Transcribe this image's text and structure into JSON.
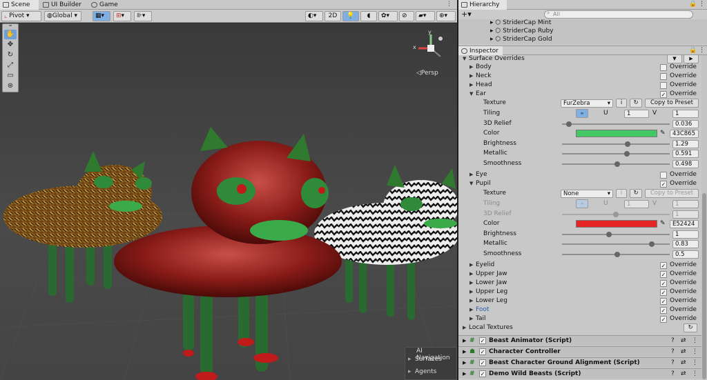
{
  "scene": {
    "tabs": [
      "Scene",
      "UI Builder",
      "Game"
    ],
    "toolbar": {
      "pivot": "Pivot",
      "global": "Global",
      "mode_2d": "2D"
    },
    "persp_label": "◁Persp",
    "gizmo_labels": {
      "y": "y",
      "x": "x"
    },
    "ai_nav": {
      "title": "AI Navigation",
      "items": [
        "Surfaces",
        "Agents"
      ]
    }
  },
  "hierarchy": {
    "title": "Hierarchy",
    "search_placeholder": "All",
    "items": [
      "StriderCap Mint",
      "StriderCap Ruby",
      "StriderCap Gold"
    ]
  },
  "inspector": {
    "title": "Inspector",
    "section": "Surface Overrides",
    "override_label": "Override",
    "parts_top": [
      {
        "label": "Body",
        "checked": false
      },
      {
        "label": "Neck",
        "checked": false
      },
      {
        "label": "Head",
        "checked": false
      },
      {
        "label": "Ear",
        "checked": true
      }
    ],
    "ear": {
      "texture_label": "Texture",
      "texture_value": "FurZebra",
      "copy_preset": "Copy to Preset",
      "tiling_label": "Tiling",
      "u_label": "U",
      "v_label": "V",
      "u_value": "1",
      "v_value": "1",
      "relief_label": "3D Relief",
      "relief_value": "0.036",
      "relief_fraction": 0.04,
      "color_label": "Color",
      "color_hex": "43C865",
      "color": "#43c865",
      "brightness_label": "Brightness",
      "brightness_value": "1.29",
      "brightness_fraction": 0.6,
      "metallic_label": "Metallic",
      "metallic_value": "0.591",
      "metallic_fraction": 0.591,
      "smoothness_label": "Smoothness",
      "smoothness_value": "0.498",
      "smoothness_fraction": 0.498
    },
    "parts_mid": [
      {
        "label": "Eye",
        "checked": false
      },
      {
        "label": "Pupil",
        "checked": true
      }
    ],
    "pupil": {
      "texture_label": "Texture",
      "texture_value": "None",
      "copy_preset": "Copy to Preset",
      "tiling_label": "Tiling",
      "u_label": "U",
      "v_label": "V",
      "u_value": "1",
      "v_value": "1",
      "relief_label": "3D Relief",
      "relief_value": "1",
      "color_label": "Color",
      "color_hex": "E52424",
      "color": "#e52424",
      "brightness_label": "Brightness",
      "brightness_value": "1",
      "brightness_fraction": 0.42,
      "metallic_label": "Metallic",
      "metallic_value": "0.83",
      "metallic_fraction": 0.83,
      "smoothness_label": "Smoothness",
      "smoothness_value": "0.5",
      "smoothness_fraction": 0.5
    },
    "parts_bottom": [
      {
        "label": "Eyelid",
        "checked": true
      },
      {
        "label": "Upper Jaw",
        "checked": true
      },
      {
        "label": "Lower Jaw",
        "checked": true
      },
      {
        "label": "Upper Leg",
        "checked": true
      },
      {
        "label": "Lower Leg",
        "checked": true
      },
      {
        "label": "Foot",
        "checked": true,
        "highlight": true
      },
      {
        "label": "Tail",
        "checked": true
      }
    ],
    "local_textures": "Local Textures",
    "components": [
      "Beast Animator (Script)",
      "Character Controller",
      "Beast Character Ground Alignment (Script)",
      "Demo Wild Beasts (Script)"
    ]
  }
}
